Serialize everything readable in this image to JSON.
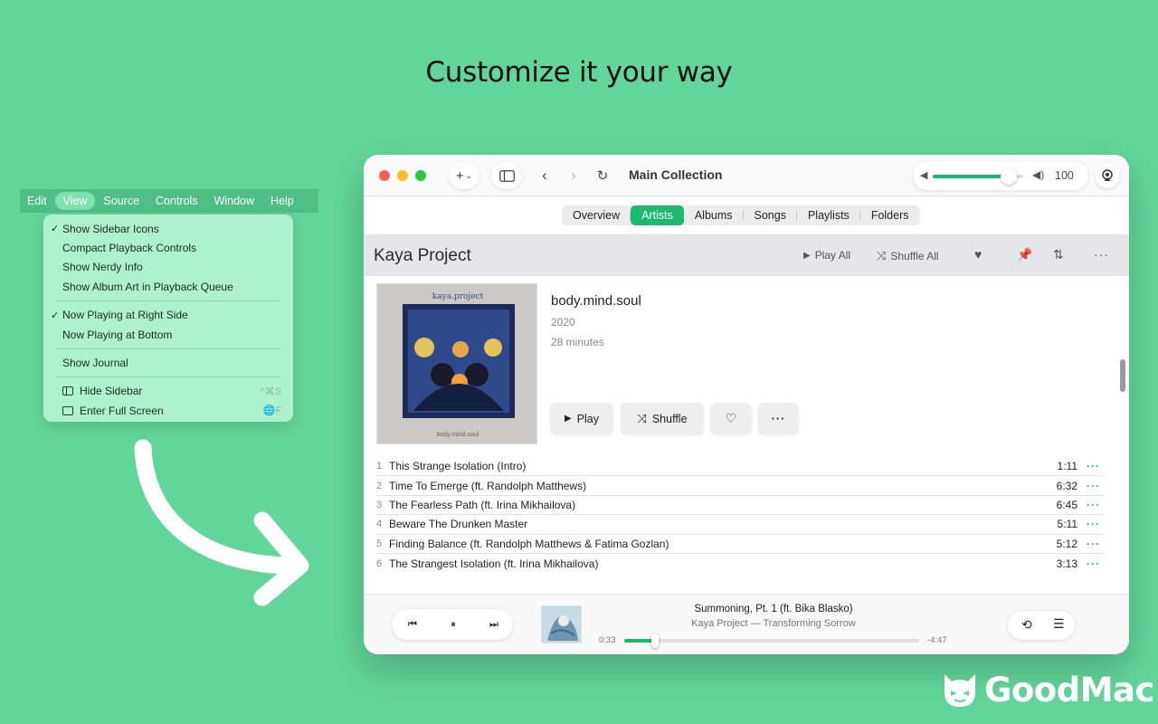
{
  "headline": "Customize it your way",
  "menubar": {
    "items": [
      "Edit",
      "View",
      "Source",
      "Controls",
      "Window",
      "Help"
    ],
    "active": "View"
  },
  "view_menu": {
    "show_sidebar_icons": "Show Sidebar Icons",
    "compact_playback": "Compact Playback Controls",
    "nerdy_info": "Show Nerdy Info",
    "album_art_queue": "Show Album Art in Playback Queue",
    "now_playing_right": "Now Playing at Right Side",
    "now_playing_bottom": "Now Playing at Bottom",
    "show_journal": "Show Journal",
    "hide_sidebar": "Hide Sidebar",
    "hide_sidebar_shortcut": "^⌘S",
    "full_screen": "Enter Full Screen",
    "full_screen_shortcut": "🌐F",
    "check_mark": "✓"
  },
  "window": {
    "collection_title": "Main Collection",
    "volume_value": "100",
    "volume_level": 0.84,
    "tabs": [
      "Overview",
      "Artists",
      "Albums",
      "Songs",
      "Playlists",
      "Folders"
    ],
    "selected_tab": "Artists"
  },
  "artist": {
    "name": "Kaya Project",
    "play_all": "Play All",
    "shuffle_all": "Shuffle All"
  },
  "album": {
    "title": "body.mind.soul",
    "year": "2020",
    "duration": "28 minutes",
    "cover_label": "kaya.project",
    "cover_subtitle": "body.mind.soul",
    "play": "Play",
    "shuffle": "Shuffle"
  },
  "tracks": [
    {
      "num": "1",
      "title": "This Strange Isolation (Intro)",
      "duration": "1:11"
    },
    {
      "num": "2",
      "title": "Time To Emerge (ft. Randolph Matthews)",
      "duration": "6:32"
    },
    {
      "num": "3",
      "title": "The Fearless Path (ft. Irina Mikhailova)",
      "duration": "6:45"
    },
    {
      "num": "4",
      "title": "Beware The Drunken Master",
      "duration": "5:11"
    },
    {
      "num": "5",
      "title": "Finding Balance (ft. Randolph Matthews & Fatima Gozlan)",
      "duration": "5:12"
    },
    {
      "num": "6",
      "title": "The Strangest Isolation (ft. Irina Mikhailova)",
      "duration": "3:13"
    }
  ],
  "now_playing": {
    "title": "Summoning, Pt. 1 (ft. Bika Blasko)",
    "subtitle": "Kaya Project — Transforming Sorrow",
    "elapsed": "0:33",
    "remaining": "-4:47",
    "progress": 0.105
  },
  "brand": {
    "name": "GoodMac"
  },
  "colors": {
    "background": "#62d59a",
    "accent": "#1db86d",
    "menu_bg": "#aef2cd"
  }
}
